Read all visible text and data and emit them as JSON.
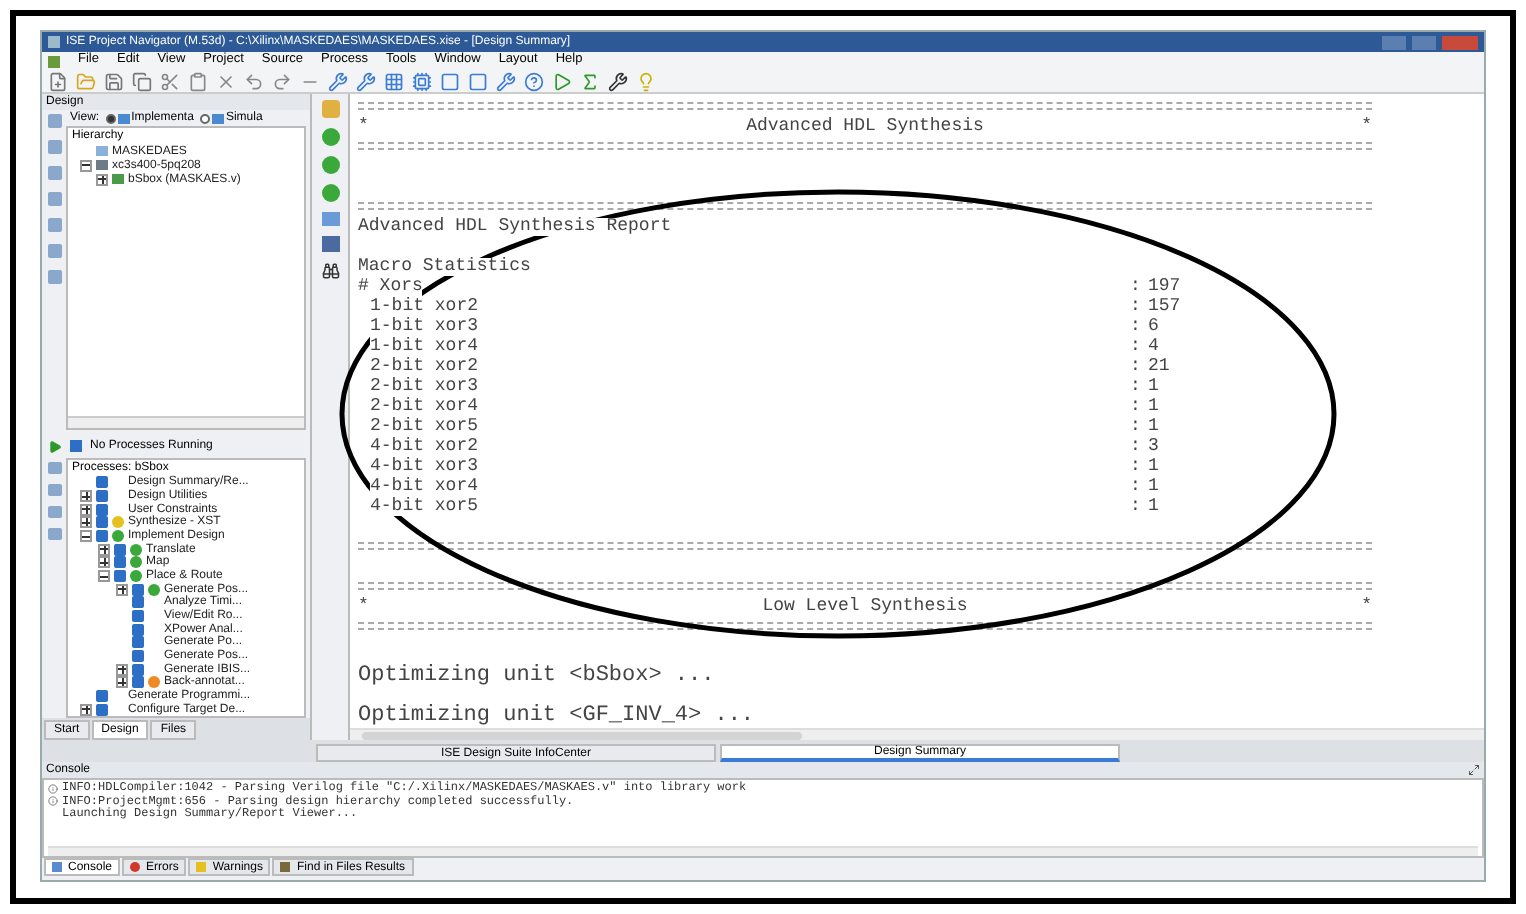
{
  "window": {
    "title": "ISE Project Navigator (M.53d) - C:\\Xilinx\\MASKEDAES\\MASKEDAES.xise - [Design Summary]"
  },
  "menu": [
    "File",
    "Edit",
    "View",
    "Project",
    "Source",
    "Process",
    "Tools",
    "Window",
    "Layout",
    "Help"
  ],
  "design_panel": {
    "title": "Design",
    "view_label": "View:",
    "view_options": [
      {
        "label": "Implementa",
        "selected": true
      },
      {
        "label": "Simula",
        "selected": false
      }
    ],
    "hierarchy_title": "Hierarchy",
    "hierarchy": [
      {
        "label": "MASKEDAES",
        "kind": "project"
      },
      {
        "label": "xc3s400-5pq208",
        "kind": "device",
        "expanded": true,
        "children": [
          {
            "label": "bSbox (MASKAES.v)",
            "kind": "module",
            "expanded": false
          }
        ]
      }
    ]
  },
  "process_status": "No Processes Running",
  "processes": {
    "title": "Processes: bSbox",
    "items": [
      {
        "label": "Design Summary/Re..."
      },
      {
        "label": "Design Utilities",
        "expanded": false
      },
      {
        "label": "User Constraints",
        "expanded": false
      },
      {
        "label": "Synthesize - XST",
        "expanded": false,
        "kind": "warning"
      },
      {
        "label": "Implement Design",
        "expanded": true,
        "kind": "ok",
        "children": [
          {
            "label": "Translate",
            "expanded": false,
            "kind": "ok"
          },
          {
            "label": "Map",
            "expanded": false,
            "kind": "ok"
          },
          {
            "label": "Place & Route",
            "expanded": true,
            "kind": "ok",
            "children": [
              {
                "label": "Generate Pos...",
                "expanded": false,
                "kind": "ok"
              },
              {
                "label": "Analyze Timi..."
              },
              {
                "label": "View/Edit Ro..."
              },
              {
                "label": "XPower Anal..."
              },
              {
                "label": "Generate Po..."
              },
              {
                "label": "Generate Pos..."
              },
              {
                "label": "Generate IBIS...",
                "expanded": false
              },
              {
                "label": "Back-annotat...",
                "expanded": false,
                "kind": "pending"
              }
            ]
          }
        ]
      },
      {
        "label": "Generate Programmi..."
      },
      {
        "label": "Configure Target De...",
        "expanded": false
      }
    ]
  },
  "left_tabs": [
    {
      "label": "Start",
      "selected": false
    },
    {
      "label": "Design",
      "selected": true
    },
    {
      "label": "Files",
      "selected": false
    }
  ],
  "report": [
    {
      "kind": "rule"
    },
    {
      "kind": "banner",
      "left": "*",
      "title": "Advanced HDL Synthesis",
      "right": "*"
    },
    {
      "kind": "rule"
    },
    {
      "kind": "blank"
    },
    {
      "kind": "blank"
    },
    {
      "kind": "rule"
    },
    {
      "kind": "text",
      "text": "Advanced HDL Synthesis Report"
    },
    {
      "kind": "blank"
    },
    {
      "kind": "text",
      "text": "Macro Statistics"
    },
    {
      "kind": "stat",
      "label": "# Xors",
      "sep": ":",
      "value": "197"
    },
    {
      "kind": "substat",
      "label": "1-bit xor2",
      "sep": ":",
      "value": "157"
    },
    {
      "kind": "substat",
      "label": "1-bit xor3",
      "sep": ":",
      "value": "6"
    },
    {
      "kind": "substat",
      "label": "1-bit xor4",
      "sep": ":",
      "value": "4"
    },
    {
      "kind": "substat",
      "label": "2-bit xor2",
      "sep": ":",
      "value": "21"
    },
    {
      "kind": "substat",
      "label": "2-bit xor3",
      "sep": ":",
      "value": "1"
    },
    {
      "kind": "substat",
      "label": "2-bit xor4",
      "sep": ":",
      "value": "1"
    },
    {
      "kind": "substat",
      "label": "2-bit xor5",
      "sep": ":",
      "value": "1"
    },
    {
      "kind": "substat",
      "label": "4-bit xor2",
      "sep": ":",
      "value": "3"
    },
    {
      "kind": "substat",
      "label": "4-bit xor3",
      "sep": ":",
      "value": "1"
    },
    {
      "kind": "substat",
      "label": "4-bit xor4",
      "sep": ":",
      "value": "1"
    },
    {
      "kind": "substat",
      "label": "4-bit xor5",
      "sep": ":",
      "value": "1"
    },
    {
      "kind": "blank"
    },
    {
      "kind": "rule"
    },
    {
      "kind": "blank"
    },
    {
      "kind": "rule"
    },
    {
      "kind": "banner",
      "left": "*",
      "title": "Low Level Synthesis",
      "right": "*"
    },
    {
      "kind": "rule"
    },
    {
      "kind": "blank"
    },
    {
      "kind": "big",
      "text": "Optimizing unit <bSbox> ..."
    },
    {
      "kind": "big",
      "text": "Optimizing unit <GF_INV_4> ..."
    }
  ],
  "editor_tabs": [
    {
      "label": "ISE Design Suite InfoCenter",
      "selected": false
    },
    {
      "label": "Design Summary",
      "selected": true
    }
  ],
  "console": {
    "title": "Console",
    "lines": [
      {
        "kind": "info",
        "text": "INFO:HDLCompiler:1042 - Parsing Verilog file \"C:/.Xilinx/MASKEDAES/MASKAES.v\" into library work"
      },
      {
        "kind": "info",
        "text": "INFO:ProjectMgmt:656 - Parsing design hierarchy completed successfully."
      },
      {
        "kind": "plain",
        "text": "Launching Design Summary/Report Viewer..."
      }
    ]
  },
  "console_tabs": [
    {
      "label": "Console",
      "kind": "console",
      "selected": true
    },
    {
      "label": "Errors",
      "kind": "errors",
      "selected": false
    },
    {
      "label": "Warnings",
      "kind": "warnings",
      "selected": false
    },
    {
      "label": "Find in Files Results",
      "kind": "find",
      "selected": false
    }
  ]
}
